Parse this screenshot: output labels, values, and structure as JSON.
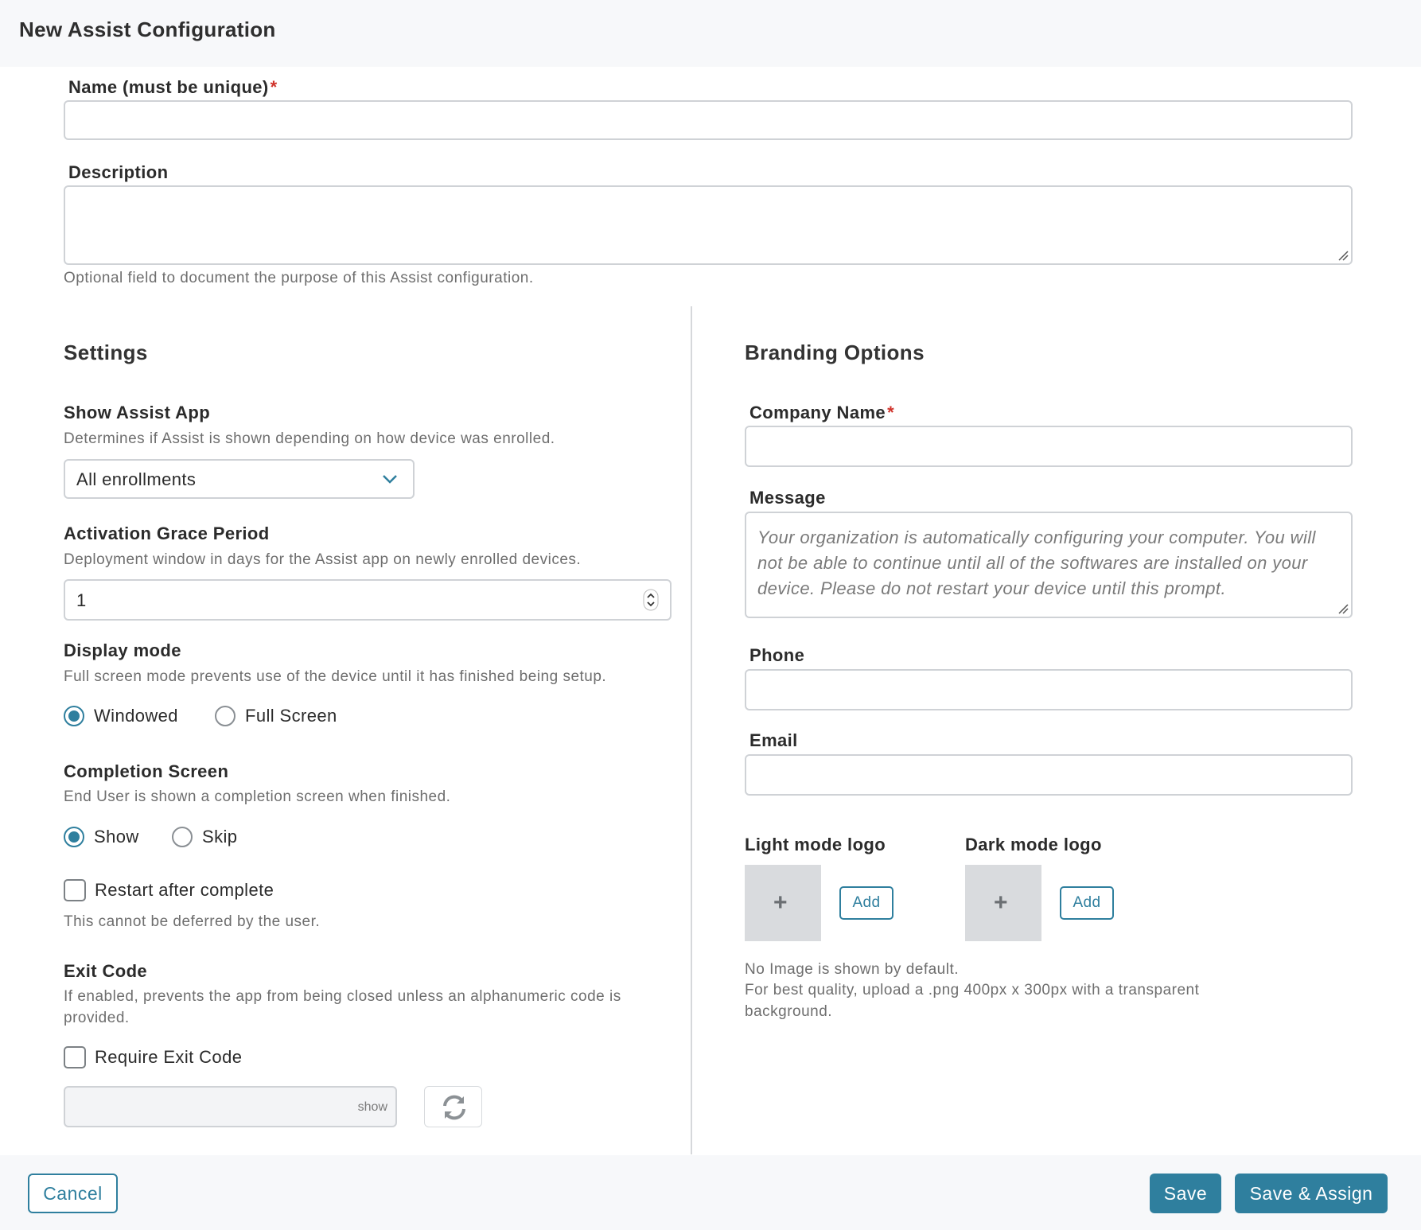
{
  "header": {
    "title": "New Assist Configuration"
  },
  "form": {
    "name_label": "Name (must be unique)",
    "required_mark": "*",
    "name_value": "",
    "description_label": "Description",
    "description_value": "",
    "description_help": "Optional field to document the purpose of this Assist configuration."
  },
  "settings": {
    "title": "Settings",
    "show_assist": {
      "label": "Show Assist App",
      "help": "Determines if Assist is shown depending on how device was enrolled.",
      "selected": "All enrollments"
    },
    "grace_period": {
      "label": "Activation Grace Period",
      "help": "Deployment window in days for the Assist app on newly enrolled devices.",
      "value": "1"
    },
    "display_mode": {
      "label": "Display mode",
      "help": "Full screen mode prevents use of the device until it has finished being setup.",
      "options": [
        "Windowed",
        "Full Screen"
      ],
      "selected": "Windowed"
    },
    "completion_screen": {
      "label": "Completion Screen",
      "help": "End User is shown a completion screen when finished.",
      "options": [
        "Show",
        "Skip"
      ],
      "selected": "Show"
    },
    "restart": {
      "label": "Restart after complete",
      "help": "This cannot be deferred by the user.",
      "checked": false
    },
    "exit_code": {
      "label": "Exit Code",
      "help": "If enabled, prevents the app from being closed unless an alphanumeric code is provided.",
      "require_label": "Require Exit Code",
      "checked": false,
      "show_label": "show",
      "refresh_icon": "refresh-icon"
    }
  },
  "branding": {
    "title": "Branding Options",
    "company_label": "Company Name",
    "company_value": "",
    "message_label": "Message",
    "message_placeholder": "Your organization is automatically configuring your computer. You will not be able to continue until all of the softwares are installed on your device. Please do not restart your device until this prompt.",
    "phone_label": "Phone",
    "email_label": "Email",
    "light_logo_label": "Light mode logo",
    "dark_logo_label": "Dark mode logo",
    "add_label": "Add",
    "plus_glyph": "+",
    "logo_help_1": "No Image is shown by default.",
    "logo_help_2": "For best quality, upload a .png 400px x 300px with a transparent background."
  },
  "footer": {
    "cancel": "Cancel",
    "save": "Save",
    "save_assign": "Save & Assign"
  },
  "colors": {
    "accent": "#2f7f9e",
    "required": "#d0342c"
  }
}
